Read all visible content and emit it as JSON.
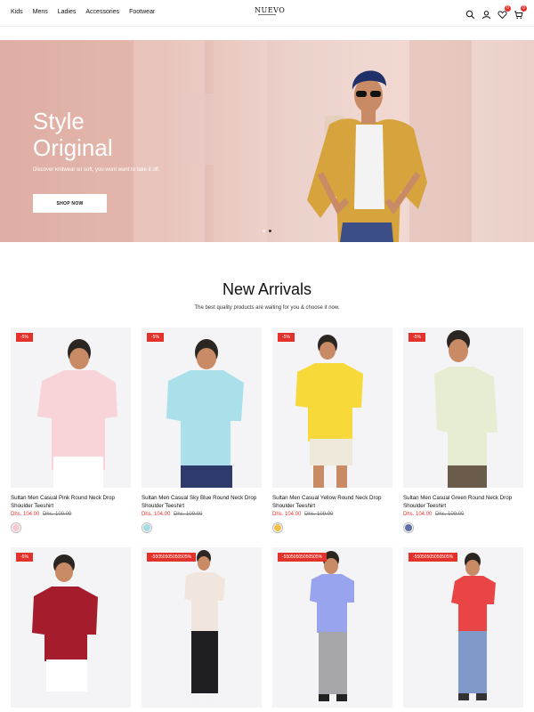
{
  "header": {
    "nav": [
      "Kids",
      "Mens",
      "Ladies",
      "Accessories",
      "Footwear"
    ],
    "logo_text": "NUEVO",
    "cart_count": "0",
    "wishlist_count": "0"
  },
  "hero": {
    "title_line1": "Style",
    "title_line2": "Original",
    "subtitle": "Discover knitwear so soft, you wont want to take it off.",
    "button_label": "SHOP NOW"
  },
  "section": {
    "title": "New Arrivals",
    "subtitle": "The best quality products are waiting for you & choose it now."
  },
  "products": [
    {
      "sale": "-5%",
      "name": "Sultan Men Casual Pink Round Neck Drop Shoulder Teeshirt",
      "price": "Dhs. 104.00",
      "old_price": "Dhs. 109.00",
      "swatch": "#f4c9cf"
    },
    {
      "sale": "-5%",
      "name": "Sultan Men Casual Sky Blue Round Neck Drop Shoulder Teeshirt",
      "price": "Dhs. 104.00",
      "old_price": "Dhs. 109.00",
      "swatch": "#a6dbe4"
    },
    {
      "sale": "-5%",
      "name": "Sultan Men Casual Yellow Round Neck Drop Shoulder Teeshirt",
      "price": "Dhs. 104.00",
      "old_price": "Dhs. 109.00",
      "swatch": "#f2c04a"
    },
    {
      "sale": "-5%",
      "name": "Sultan Men Casual Green Round Neck Drop Shoulder Teeshirt",
      "price": "Dhs. 104.00",
      "old_price": "Dhs. 109.00",
      "swatch": "#5f6fa6"
    },
    {
      "sale": "-5%"
    },
    {
      "sale": "-55050505050505%"
    },
    {
      "sale": "-55050505050505%"
    },
    {
      "sale": "-55050505050505%"
    }
  ],
  "colors": {
    "accent": "#e3322b",
    "hero_bg": "#e3b7ad"
  }
}
